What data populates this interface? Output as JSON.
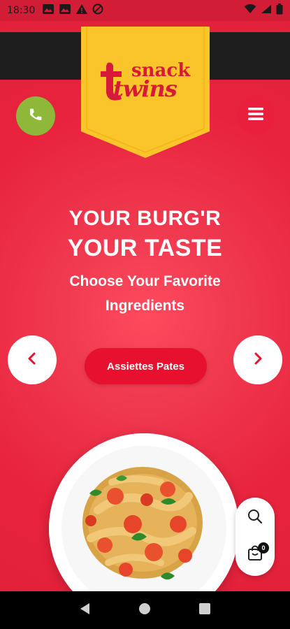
{
  "status_bar": {
    "time": "18:30",
    "icons_left": [
      "gallery-icon",
      "gallery-icon",
      "warning-icon",
      "blocked-icon"
    ],
    "icons_right": [
      "wifi-icon",
      "signal-icon",
      "battery-icon"
    ]
  },
  "brand": {
    "logo_word_top": "snack",
    "logo_word_bottom": "twins",
    "banner_color": "#f9c52b",
    "accent_red": "#e8233d"
  },
  "header": {
    "phone_icon": "phone-icon",
    "menu_icon": "hamburger-menu-icon"
  },
  "hero": {
    "headline_line1": "YOUR BURG'R",
    "headline_line2": "YOUR TASTE",
    "subtitle_line1": "Choose Your Favorite",
    "subtitle_line2": "Ingredients",
    "cta_label": "Assiettes Pates"
  },
  "carousel": {
    "prev_icon": "chevron-left-icon",
    "next_icon": "chevron-right-icon"
  },
  "side_tools": {
    "search_icon": "search-icon",
    "cart_icon": "shopping-bag-icon",
    "cart_count": "0"
  },
  "nav_bar": {
    "back_icon": "back-triangle-icon",
    "home_icon": "home-circle-icon",
    "recents_icon": "recents-square-icon"
  }
}
